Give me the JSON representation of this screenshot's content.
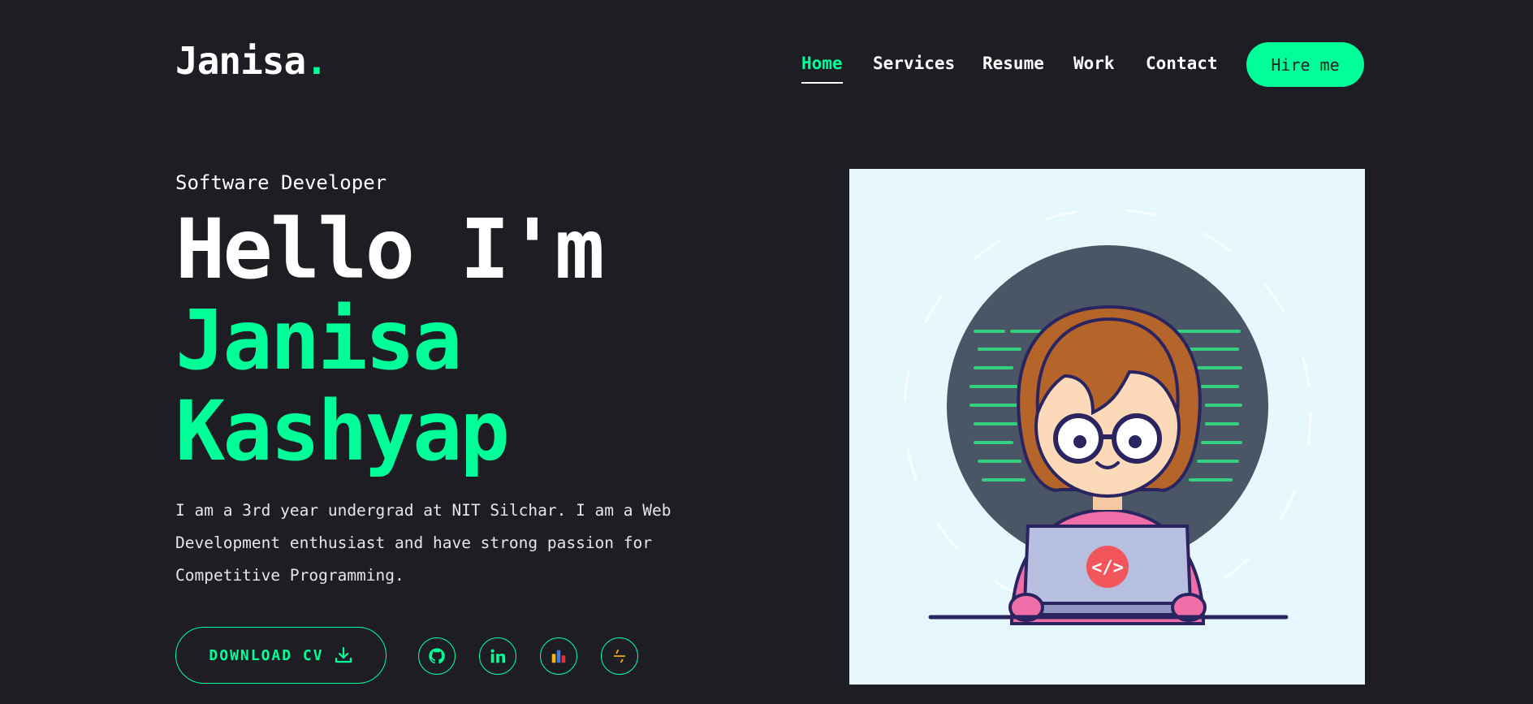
{
  "header": {
    "logo_text": "Janisa",
    "logo_dot": ".",
    "nav": [
      {
        "label": "Home",
        "active": true
      },
      {
        "label": "Services",
        "active": false
      },
      {
        "label": "Resume",
        "active": false
      },
      {
        "label": "Work",
        "active": false
      },
      {
        "label": "Contact",
        "active": false
      }
    ],
    "hire_label": "Hire me"
  },
  "hero": {
    "role": "Software Developer",
    "greeting": "Hello I'm",
    "first_name": "Janisa",
    "last_name": "Kashyap",
    "bio": "I am a 3rd year undergrad at NIT Silchar. I am a Web Development enthusiast and have strong passion for Competitive Programming.",
    "download_label": "DOWNLOAD CV",
    "socials": [
      {
        "icon": "github-icon"
      },
      {
        "icon": "linkedin-icon"
      },
      {
        "icon": "codechef-icon"
      },
      {
        "icon": "codeforces-icon"
      }
    ]
  },
  "colors": {
    "background": "#1e1d23",
    "accent": "#00ff99",
    "text": "#ffffff",
    "photo_bg": "#e6f8fd"
  },
  "illustration": {
    "badge_text": "</>"
  }
}
